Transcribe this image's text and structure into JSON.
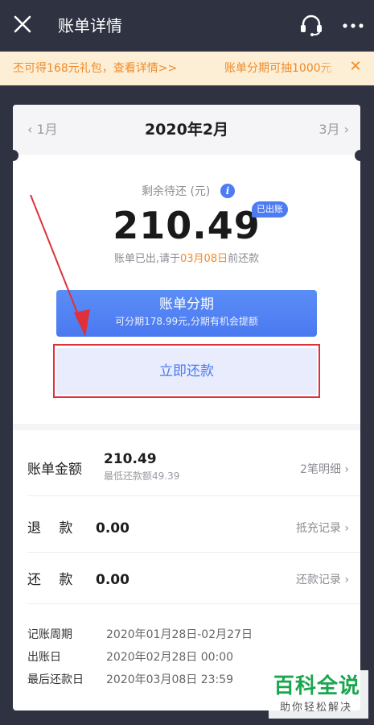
{
  "header": {
    "title": "账单详情",
    "close_icon": "close-icon",
    "service_icon": "headset-icon",
    "more_icon": "more-icon"
  },
  "banner": {
    "message_1": "丕可得168元礼包，查看详情>>",
    "message_2": "账单分期可抽1000元",
    "close_glyph": "✕"
  },
  "bill": {
    "prev_month": "‹ 1月",
    "current_month": "2020年2月",
    "next_month": "3月 ›",
    "remaining_label": "剩余待还 (元)",
    "info_glyph": "i",
    "remaining_amount": "210.49",
    "status_badge": "已出账",
    "due_prefix": "账单已出,请于",
    "due_date": "03月08日",
    "due_suffix": "前还款"
  },
  "actions": {
    "installment_title": "账单分期",
    "installment_sub": "可分期178.99元,分期有机会提额",
    "pay_now": "立即还款"
  },
  "details": {
    "bill_amount_label": "账单金额",
    "bill_amount_value": "210.49",
    "min_payment": "最低还款额49.39",
    "bill_detail_link": "2笔明细 ›",
    "refund_label": "退　 款",
    "refund_value": "0.00",
    "refund_link": "抵充记录 ›",
    "repaid_label": "还　 款",
    "repaid_value": "0.00",
    "repaid_link": "还款记录 ›"
  },
  "meta": [
    {
      "key": "记账周期",
      "value": "2020年01月28日-02月27日"
    },
    {
      "key": "出账日",
      "value": "2020年02月28日 00:00"
    },
    {
      "key": "最后还款日",
      "value": "2020年03月08日 23:59"
    }
  ],
  "watermark": {
    "title": "百科全说",
    "subtitle": "助你轻松解决"
  },
  "colors": {
    "background": "#2f3241",
    "accent_blue": "#4a79f0",
    "accent_orange": "#f08a2a",
    "highlight_red": "#e0303a"
  }
}
